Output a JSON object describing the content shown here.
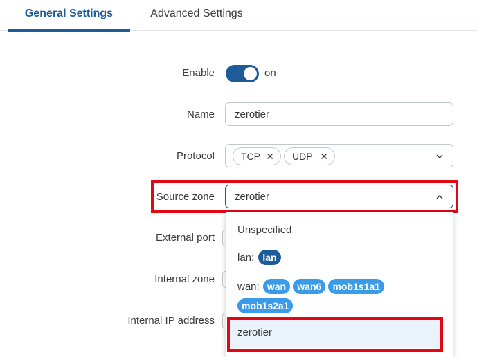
{
  "tabs": {
    "general": "General Settings",
    "advanced": "Advanced Settings"
  },
  "form": {
    "enable": {
      "label": "Enable",
      "state_text": "on"
    },
    "name": {
      "label": "Name",
      "value": "zerotier"
    },
    "protocol": {
      "label": "Protocol",
      "chips": [
        "TCP",
        "UDP"
      ]
    },
    "source_zone": {
      "label": "Source zone",
      "value": "zerotier"
    },
    "external_port": {
      "label": "External port"
    },
    "internal_zone": {
      "label": "Internal zone"
    },
    "internal_ip": {
      "label": "Internal IP address"
    }
  },
  "dropdown": {
    "unspecified": "Unspecified",
    "lan_label": "lan:",
    "lan_badges": [
      "lan"
    ],
    "wan_label": "wan:",
    "wan_badges": [
      "wan",
      "wan6",
      "mob1s1a1",
      "mob1s2a1"
    ],
    "selected": "zerotier"
  },
  "icons": {
    "chip_remove": "close-icon",
    "protocol_arrow": "chevron-down-icon",
    "source_zone_arrow": "chevron-up-icon"
  },
  "colors": {
    "accent": "#1d5c99",
    "badge_wan": "#3a9be8",
    "highlight": "#e30613"
  }
}
